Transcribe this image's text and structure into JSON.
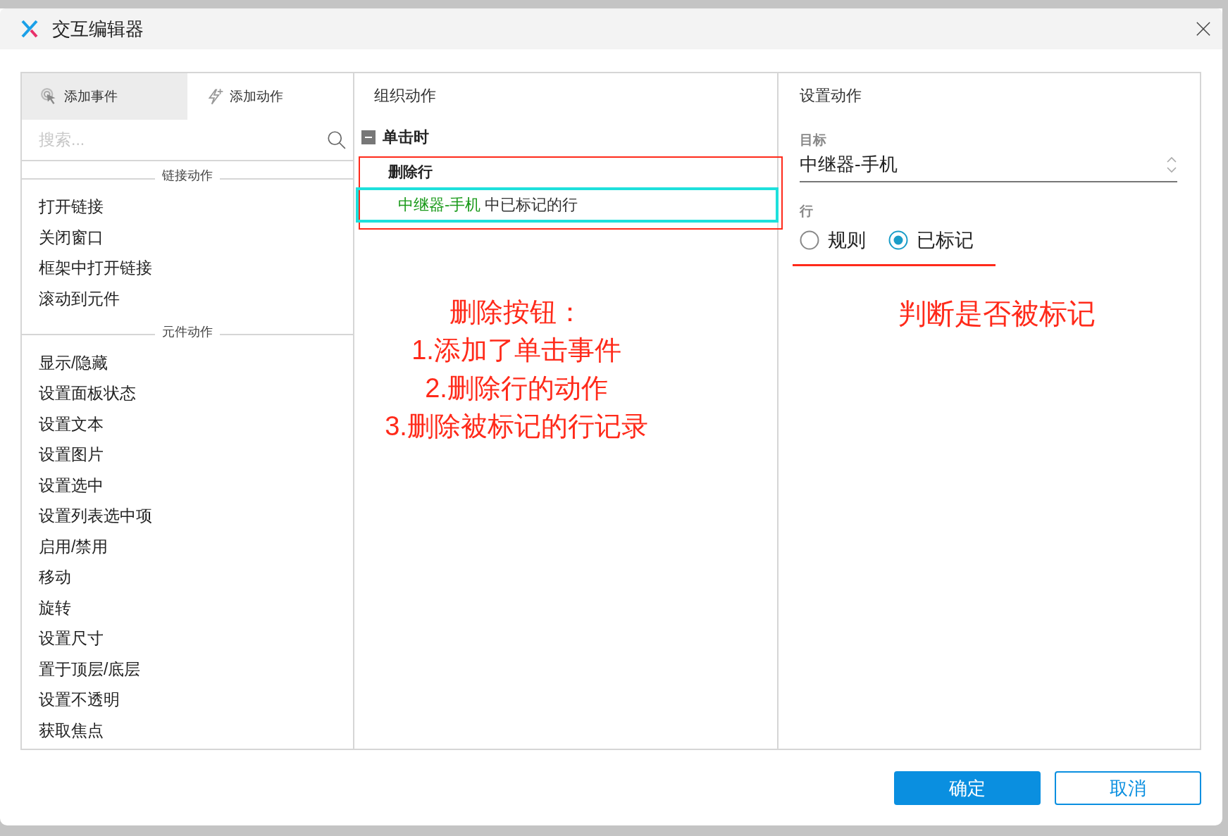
{
  "window": {
    "title": "交互编辑器"
  },
  "left_panel": {
    "tabs": [
      {
        "label": "添加事件",
        "selected": true
      },
      {
        "label": "添加动作",
        "selected": false
      }
    ],
    "search": {
      "placeholder": "搜索..."
    },
    "groups": [
      {
        "title": "链接动作",
        "items": [
          "打开链接",
          "关闭窗口",
          "框架中打开链接",
          "滚动到元件"
        ]
      },
      {
        "title": "元件动作",
        "items": [
          "显示/隐藏",
          "设置面板状态",
          "设置文本",
          "设置图片",
          "设置选中",
          "设置列表选中项",
          "启用/禁用",
          "移动",
          "旋转",
          "设置尺寸",
          "置于顶层/底层",
          "设置不透明",
          "获取焦点"
        ]
      }
    ]
  },
  "middle_panel": {
    "title": "组织动作",
    "event": {
      "label": "单击时",
      "expanded": true,
      "actions": [
        {
          "label": "删除行",
          "target": "中继器-手机",
          "detail": "中已标记的行",
          "selected": true
        }
      ]
    },
    "annotation": [
      "删除按钮：",
      "1.添加了单击事件",
      "2.删除行的动作",
      "3.删除被标记的行记录"
    ]
  },
  "right_panel": {
    "title": "设置动作",
    "target_label": "目标",
    "target_value": "中继器-手机",
    "rows_label": "行",
    "options": [
      {
        "label": "规则",
        "selected": false
      },
      {
        "label": "已标记",
        "selected": true
      }
    ],
    "annotation": [
      "判断是否被标记"
    ]
  },
  "buttons": [
    {
      "label": "确定",
      "kind": "primary"
    },
    {
      "label": "取消",
      "kind": "secondary"
    }
  ]
}
